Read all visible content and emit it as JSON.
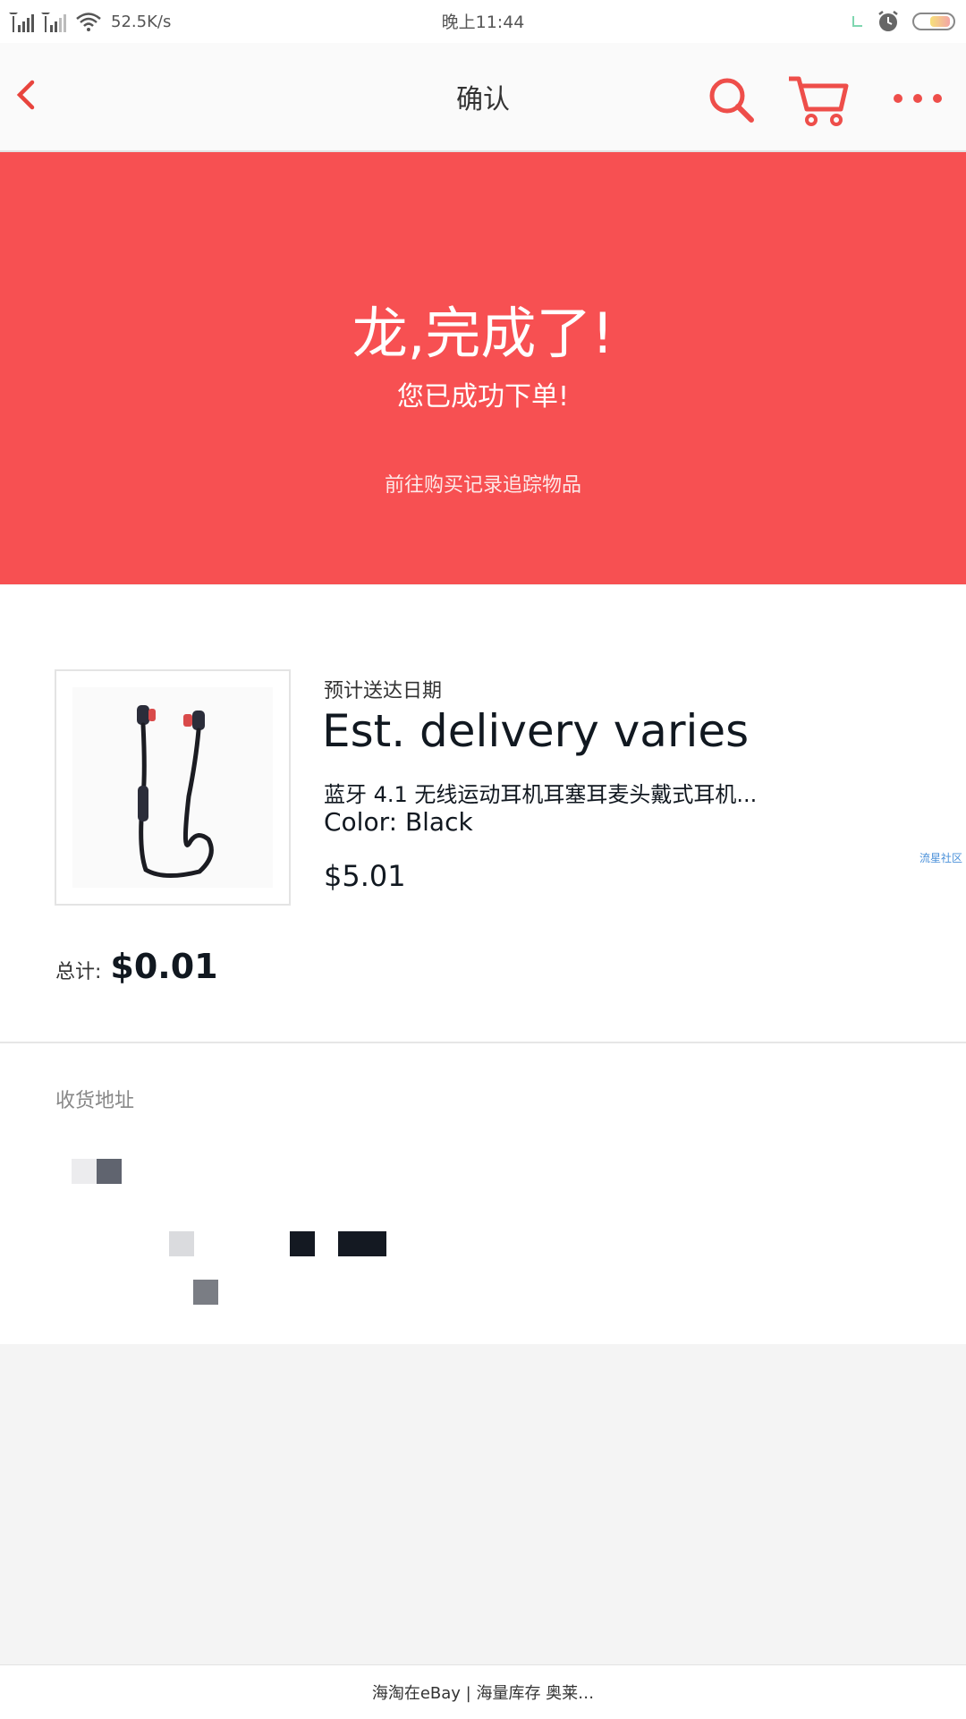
{
  "status_bar": {
    "net_speed": "52.5K/s",
    "time": "晚上11:44"
  },
  "app_bar": {
    "title": "确认",
    "icons": [
      "back-chevron-icon",
      "search-icon",
      "cart-icon",
      "more-icon"
    ]
  },
  "hero": {
    "title": "龙,完成了!",
    "subtitle": "您已成功下单!",
    "link": "前往购买记录追踪物品",
    "color": "#f75052"
  },
  "item": {
    "est_label": "预计送达日期",
    "est_value": "Est. delivery varies",
    "name": "蓝牙 4.1 无线运动耳机耳塞耳麦头戴式耳机...",
    "color_text": "Color: Black",
    "price": "$5.01",
    "side_tag": "流星社区"
  },
  "total": {
    "label": "总计:",
    "value": "$0.01"
  },
  "address": {
    "title": "收货地址"
  },
  "footer": {
    "text": "海淘在eBay | 海量库存 奥莱…"
  }
}
